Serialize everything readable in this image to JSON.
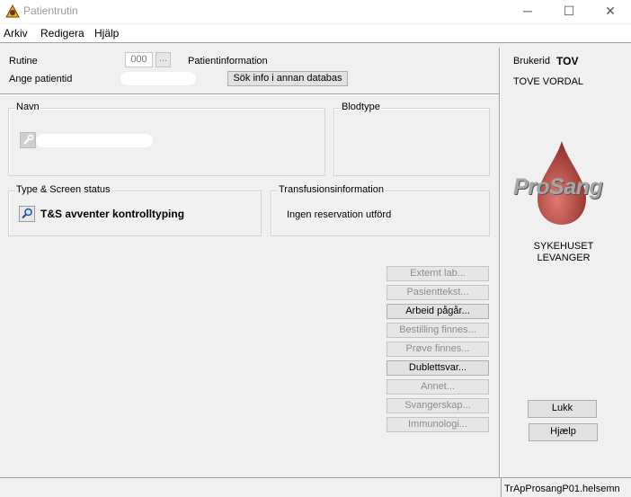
{
  "window": {
    "title": "Patientrutin",
    "min": "─",
    "max": "☐",
    "close": "✕"
  },
  "menu": [
    "Arkiv",
    "Redigera",
    "Hjälp"
  ],
  "form": {
    "rutine_label": "Rutine",
    "rutine_value": "000",
    "rutine_browse": "...",
    "patientinfo_label": "Patientinformation",
    "ange_label": "Ange patientid",
    "sok_button": "Sök info i annan databas"
  },
  "groups": {
    "navn": "Navn",
    "blodtype": "Blodtype",
    "type_screen": "Type & Screen status",
    "ts_status": "T&S avventer kontrolltyping",
    "transfusion": "Transfusionsinformation",
    "transfusion_text": "Ingen reservation utförd"
  },
  "side_buttons": [
    {
      "label": "Externt lab...",
      "enabled": false
    },
    {
      "label": "Pasienttekst...",
      "enabled": false
    },
    {
      "label": "Arbeid pågår...",
      "enabled": true
    },
    {
      "label": "Bestilling finnes...",
      "enabled": false
    },
    {
      "label": "Prøve finnes...",
      "enabled": false
    },
    {
      "label": "Dublettsvar...",
      "enabled": true
    },
    {
      "label": "Annet...",
      "enabled": false
    },
    {
      "label": "Svangerskap...",
      "enabled": false
    },
    {
      "label": "Immunologi...",
      "enabled": false
    }
  ],
  "right_panel": {
    "brukerid_label": "Brukerid",
    "brukerid_value": "TOV",
    "user_name": "TOVE VORDAL",
    "logo_text": "ProSang",
    "hospital_line1": "SYKEHUSET",
    "hospital_line2": "LEVANGER",
    "lukk": "Lukk",
    "hjaelp": "Hjælp"
  },
  "statusbar": {
    "text": "TrApProsangP01.helsemn"
  },
  "colors": {
    "drop": "#b9453f",
    "logo": "#a6a6a6"
  }
}
